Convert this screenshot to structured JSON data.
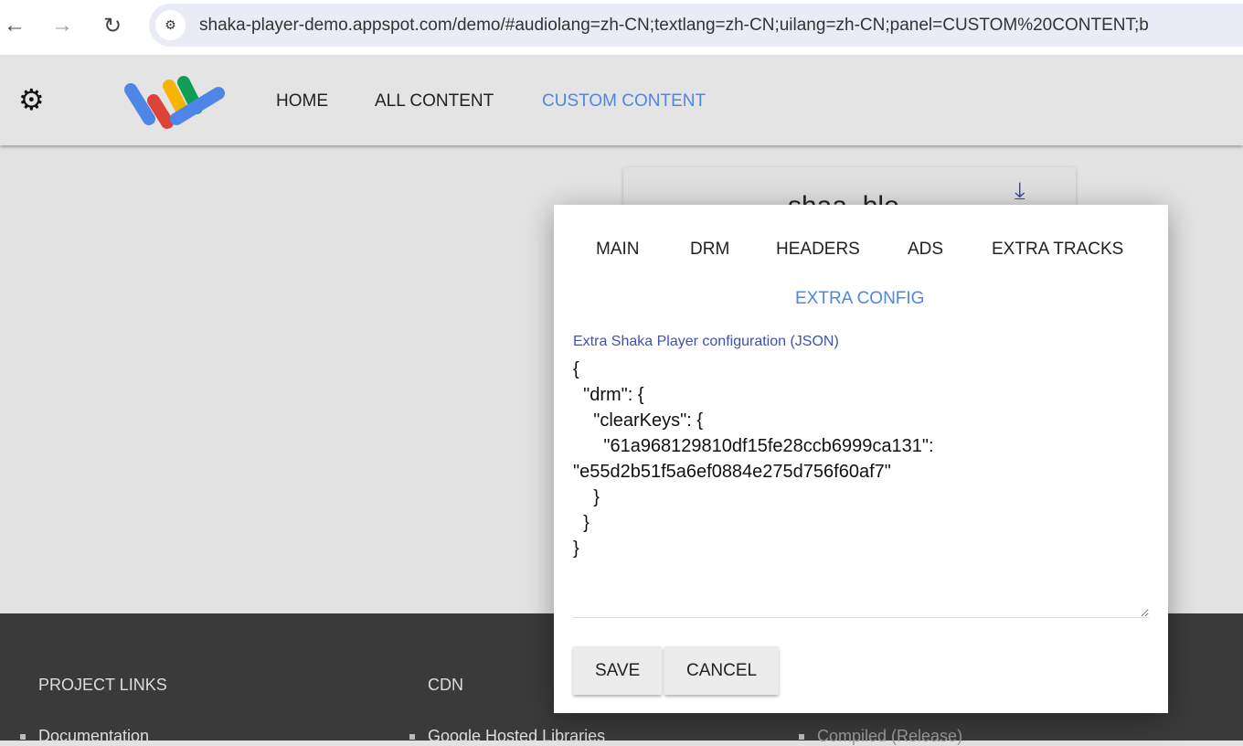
{
  "browser": {
    "url": "shaka-player-demo.appspot.com/demo/#audiolang=zh-CN;textlang=zh-CN;uilang=zh-CN;panel=CUSTOM%20CONTENT;b"
  },
  "appbar": {
    "tabs": [
      {
        "label": "HOME"
      },
      {
        "label": "ALL CONTENT"
      },
      {
        "label": "CUSTOM CONTENT",
        "active": true
      }
    ]
  },
  "card": {
    "title": "shaa_blo"
  },
  "dialog": {
    "tabs": [
      {
        "label": "MAIN"
      },
      {
        "label": "DRM"
      },
      {
        "label": "HEADERS"
      },
      {
        "label": "ADS"
      },
      {
        "label": "EXTRA TRACKS"
      },
      {
        "label": "EXTRA CONFIG",
        "active": true
      }
    ],
    "field_label": "Extra Shaka Player configuration (JSON)",
    "config_value": "{\n  \"drm\": {\n    \"clearKeys\": {\n      \"61a968129810df15fe28ccb6999ca131\":\n\"e55d2b51f5a6ef0884e275d756f60af7\"\n    }\n  }\n}",
    "save_label": "SAVE",
    "cancel_label": "CANCEL"
  },
  "footer": {
    "headings": [
      "PROJECT LINKS",
      "CDN"
    ],
    "links": [
      "Documentation",
      "Google Hosted Libraries",
      "Compiled (Release)"
    ]
  },
  "colors": {
    "accent": "#4e86e8",
    "label": "#3f51b5",
    "footer": "#3a3a3a"
  }
}
